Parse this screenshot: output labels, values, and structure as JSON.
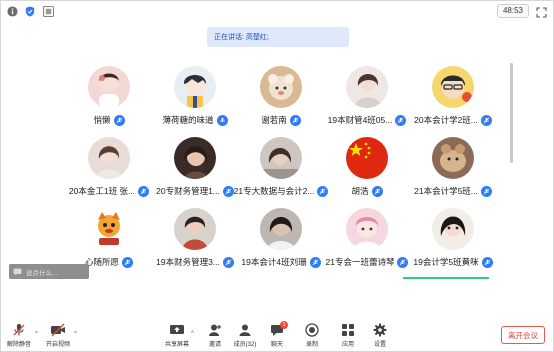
{
  "topbar": {
    "timer": "48:53"
  },
  "speaking": {
    "text": "正在讲话: 高楚红;"
  },
  "participants": [
    {
      "name": "悄懒"
    },
    {
      "name": "薄荷糖的味道"
    },
    {
      "name": "谢若南"
    },
    {
      "name": "19本财管4班05..."
    },
    {
      "name": "20本会计学2班..."
    },
    {
      "name": "20本金工1班 张..."
    },
    {
      "name": "20专财务管理1..."
    },
    {
      "name": "21专大数据与会计2..."
    },
    {
      "name": "胡浩"
    },
    {
      "name": "21本会计学5班..."
    },
    {
      "name": "心随所愿"
    },
    {
      "name": "19本财务管理3..."
    },
    {
      "name": "19本会计4班刘珊"
    },
    {
      "name": "21专会一班蕾诗琴"
    },
    {
      "name": "19会计学5班黄咪"
    }
  ],
  "chat_preview": {
    "placeholder": "说点什么..."
  },
  "toolbar": {
    "mute_label": "解除静音",
    "video_label": "开启视频",
    "share_label": "共享屏幕",
    "invite_label": "邀请",
    "members_label": "成员(32)",
    "chat_label": "聊天",
    "chat_badge": "1",
    "record_label": "录制",
    "apps_label": "应用",
    "settings_label": "设置",
    "leave_label": "离开会议"
  },
  "colors": {
    "accent": "#2f7cf6",
    "leave": "#e3463b",
    "active_speaker": "#2ecc8a",
    "speaking_bg": "#dfe9fb"
  }
}
